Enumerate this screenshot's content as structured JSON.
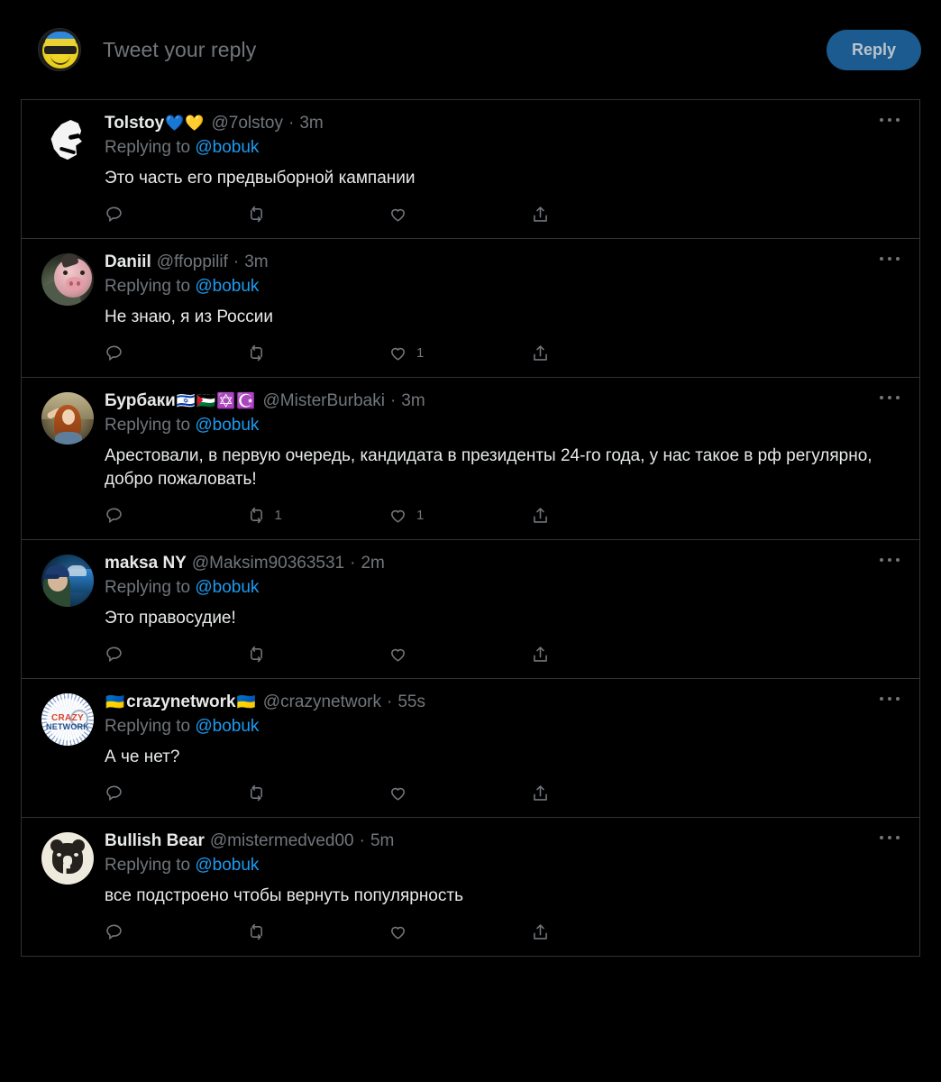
{
  "composer": {
    "placeholder": "Tweet your reply",
    "reply_button_label": "Reply",
    "avatar_name": "yellow-smiley-sunglasses-avatar"
  },
  "colors": {
    "background": "#000000",
    "border": "#2f3336",
    "primary_text": "#e7e9ea",
    "secondary_text": "#71767b",
    "link": "#1d9bf0",
    "reply_button_bg": "#1c5b8f",
    "reply_button_text": "#b9c4cc"
  },
  "actions_labels": {
    "reply": "reply-icon",
    "retweet": "retweet-icon",
    "like": "like-icon",
    "share": "share-icon",
    "more": "more-options-icon"
  },
  "replying_to_prefix": "Replying to ",
  "replying_to_handle": "@bobuk",
  "tweets": [
    {
      "display_name": "Tolstoy",
      "name_emojis": "💙💛",
      "handle": "@7olstoy",
      "separator": "·",
      "time": "3m",
      "text": "Это часть его предвыборной кампании",
      "reply_count": "",
      "retweet_count": "",
      "like_count": "",
      "avatar_name": "tolstoy-silhouette-avatar"
    },
    {
      "display_name": "Daniil",
      "name_emojis": "",
      "handle": "@ffoppilif",
      "separator": "·",
      "time": "3m",
      "text": "Не знаю, я из России",
      "reply_count": "",
      "retweet_count": "",
      "like_count": "1",
      "avatar_name": "daniil-pig-photo-avatar"
    },
    {
      "display_name": "Бурбаки",
      "name_emojis": "🇮🇱🇵🇸✡️☪️",
      "handle": "@MisterBurbaki",
      "separator": "·",
      "time": "3m",
      "text": "Арестовали, в первую очередь, кандидата в президенты 24-го года, у нас такое в рф регулярно, добро пожаловать!",
      "reply_count": "",
      "retweet_count": "1",
      "like_count": "1",
      "avatar_name": "burbaki-painting-avatar"
    },
    {
      "display_name": "maksa NY",
      "name_emojis": "",
      "handle": "@Maksim90363531",
      "separator": "·",
      "time": "2m",
      "text": "Это правосудие!",
      "reply_count": "",
      "retweet_count": "",
      "like_count": "",
      "avatar_name": "maksa-car-photo-avatar"
    },
    {
      "display_name": "crazynetwork",
      "name_emojis": "🇺🇦",
      "name_emojis_leading": "🇺🇦",
      "handle": "@crazynetwork",
      "separator": "·",
      "time": "55s",
      "text": "А че нет?",
      "reply_count": "",
      "retweet_count": "",
      "like_count": "",
      "avatar_name": "crazynetwork-logo-avatar"
    },
    {
      "display_name": "Bullish Bear",
      "name_emojis": "",
      "handle": "@mistermedved00",
      "separator": "·",
      "time": "5m",
      "text": "все подстроено чтобы вернуть популярность",
      "reply_count": "",
      "retweet_count": "",
      "like_count": "",
      "avatar_name": "bullish-bear-logo-avatar"
    }
  ]
}
